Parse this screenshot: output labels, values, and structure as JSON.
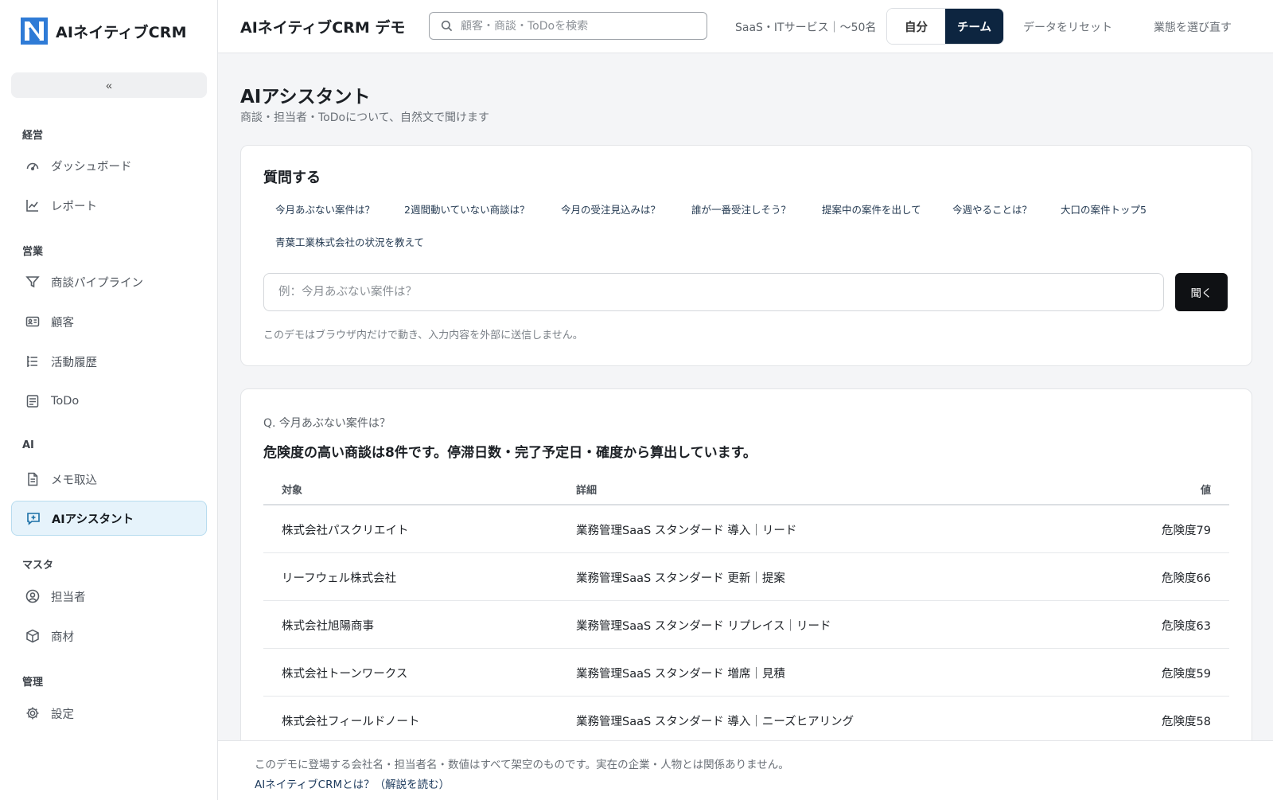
{
  "brand": {
    "name": "AIネイティブCRM"
  },
  "sidebar": {
    "collapse_label": "«",
    "sections": [
      {
        "label": "経営"
      },
      {
        "label": "営業"
      },
      {
        "label": "AI"
      },
      {
        "label": "マスタ"
      },
      {
        "label": "管理"
      }
    ],
    "items": [
      {
        "label": "ダッシュボード",
        "icon": "gauge-icon"
      },
      {
        "label": "レポート",
        "icon": "line-chart-icon"
      },
      {
        "label": "商談パイプライン",
        "icon": "filter-icon"
      },
      {
        "label": "顧客",
        "icon": "id-card-icon"
      },
      {
        "label": "活動履歴",
        "icon": "list-icon"
      },
      {
        "label": "ToDo",
        "icon": "checklist-icon"
      },
      {
        "label": "メモ取込",
        "icon": "document-icon"
      },
      {
        "label": "AIアシスタント",
        "icon": "chat-spark-icon",
        "active": true
      },
      {
        "label": "担当者",
        "icon": "user-circle-icon"
      },
      {
        "label": "商材",
        "icon": "box-icon"
      },
      {
        "label": "設定",
        "icon": "gear-icon"
      }
    ]
  },
  "header": {
    "title": "AIネイティブCRM デモ",
    "search_placeholder": "顧客・商談・ToDoを検索",
    "industry": "SaaS・ITサービス｜〜50名",
    "toggle": {
      "self": "自分",
      "team": "チーム",
      "selected": "team"
    },
    "reset_label": "データをリセット",
    "reselect_label": "業態を選び直す"
  },
  "main": {
    "title": "AIアシスタント",
    "subtitle": "商談・担当者・ToDoについて、自然文で聞けます",
    "ask": {
      "title": "質問する",
      "suggestions": [
        "今月あぶない案件は？",
        "2週間動いていない商談は？",
        "今月の受注見込みは？",
        "誰が一番受注しそう？",
        "提案中の案件を出して",
        "今週やることは？",
        "大口の案件トップ5",
        "青葉工業株式会社の状況を教えて"
      ],
      "input_placeholder": "例：今月あぶない案件は？",
      "button_label": "聞く",
      "note": "このデモはブラウザ内だけで動き、入力内容を外部に送信しません。"
    },
    "answer": {
      "question": "Q. 今月あぶない案件は？",
      "summary": "危険度の高い商談は8件です。停滞日数・完了予定日・確度から算出しています。",
      "columns": [
        "対象",
        "詳細",
        "値"
      ],
      "rows": [
        [
          "株式会社パスクリエイト",
          "業務管理SaaS スタンダード 導入｜リード",
          "危険度79"
        ],
        [
          "リーフウェル株式会社",
          "業務管理SaaS スタンダード 更新｜提案",
          "危険度66"
        ],
        [
          "株式会社旭陽商事",
          "業務管理SaaS スタンダード リプレイス｜リード",
          "危険度63"
        ],
        [
          "株式会社トーンワークス",
          "業務管理SaaS スタンダード 増席｜見積",
          "危険度59"
        ],
        [
          "株式会社フィールドノート",
          "業務管理SaaS スタンダード 導入｜ニーズヒアリング",
          "危険度58"
        ]
      ]
    }
  },
  "footer": {
    "note": "このデモに登場する会社名・担当者名・数値はすべて架空のものです。実在の企業・人物とは関係ありません。",
    "link": "AIネイティブCRMとは？（解説を読む）"
  },
  "colors": {
    "accent": "#0d2540",
    "active_bg": "#e6f3fb",
    "ask_button": "#0f1114"
  }
}
